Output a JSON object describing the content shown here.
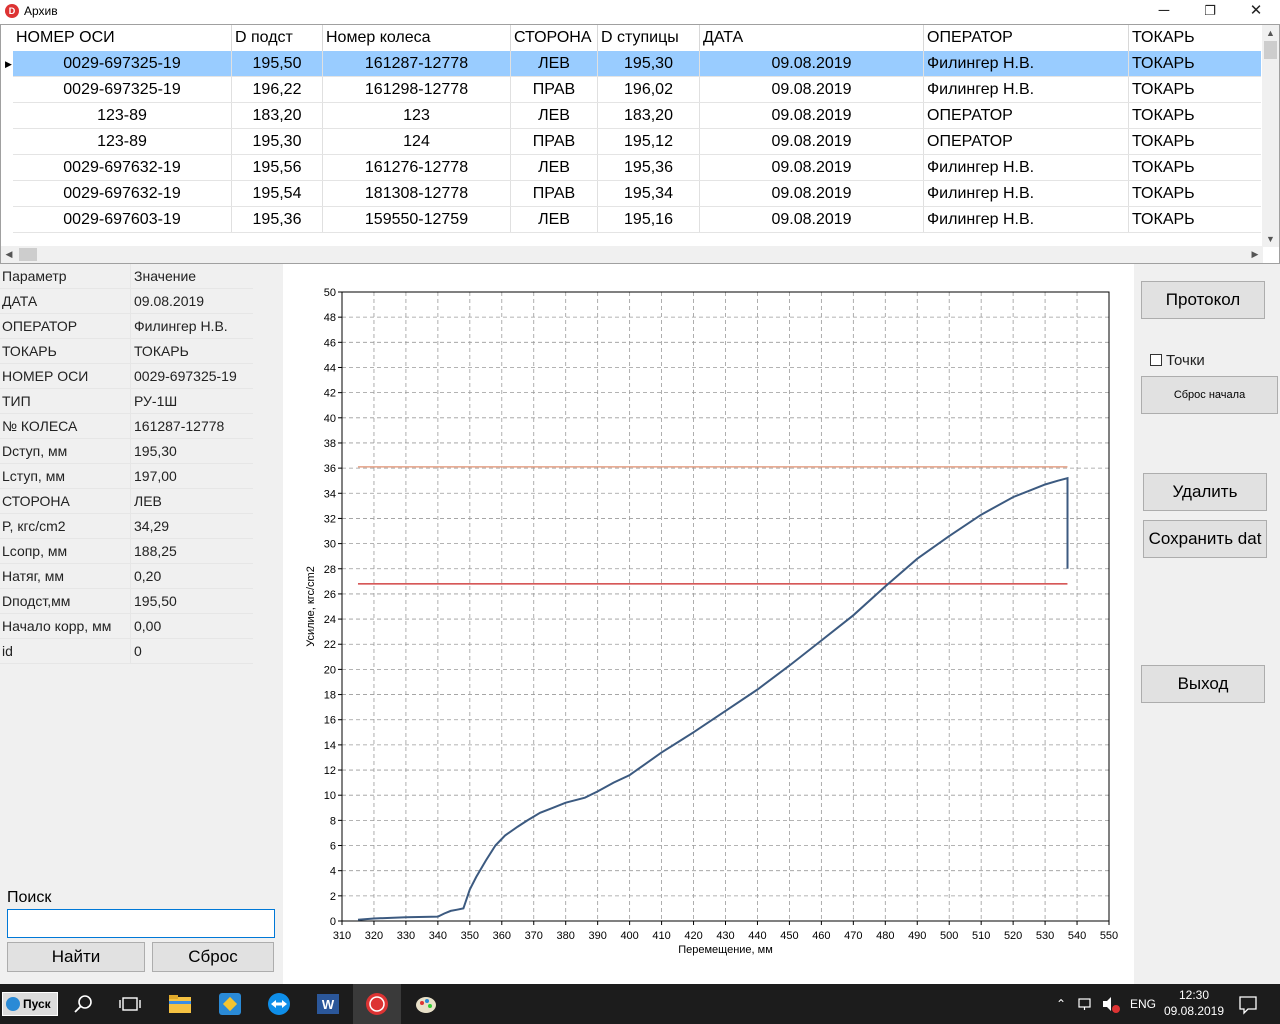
{
  "window": {
    "title": "Архив",
    "min": "─",
    "restore": "❐",
    "close": "✕"
  },
  "grid": {
    "columns": [
      "НОМЕР ОСИ",
      "D подст",
      "Номер колеса",
      "СТОРОНА",
      "D ступицы",
      "ДАТА",
      "ОПЕРАТОР",
      "ТОКАРЬ"
    ],
    "rows": [
      [
        "0029-697325-19",
        "195,50",
        "161287-12778",
        "ЛЕВ",
        "195,30",
        "09.08.2019",
        "Филингер Н.В.",
        "ТОКАРЬ"
      ],
      [
        "0029-697325-19",
        "196,22",
        "161298-12778",
        "ПРАВ",
        "196,02",
        "09.08.2019",
        "Филингер Н.В.",
        "ТОКАРЬ"
      ],
      [
        "123-89",
        "183,20",
        "123",
        "ЛЕВ",
        "183,20",
        "09.08.2019",
        "ОПЕРАТОР",
        "ТОКАРЬ"
      ],
      [
        "123-89",
        "195,30",
        "124",
        "ПРАВ",
        "195,12",
        "09.08.2019",
        "ОПЕРАТОР",
        "ТОКАРЬ"
      ],
      [
        "0029-697632-19",
        "195,56",
        "161276-12778",
        "ЛЕВ",
        "195,36",
        "09.08.2019",
        "Филингер Н.В.",
        "ТОКАРЬ"
      ],
      [
        "0029-697632-19",
        "195,54",
        "181308-12778",
        "ПРАВ",
        "195,34",
        "09.08.2019",
        "Филингер Н.В.",
        "ТОКАРЬ"
      ],
      [
        "0029-697603-19",
        "195,36",
        "159550-12759",
        "ЛЕВ",
        "195,16",
        "09.08.2019",
        "Филингер Н.В.",
        "ТОКАРЬ"
      ]
    ],
    "selected_row": 0,
    "selection_color": "#99ccff"
  },
  "params": {
    "header": [
      "Параметр",
      "Значение"
    ],
    "rows": [
      [
        "ДАТА",
        "09.08.2019"
      ],
      [
        "ОПЕРАТОР",
        "Филингер Н.В."
      ],
      [
        "ТОКАРЬ",
        "ТОКАРЬ"
      ],
      [
        "НОМЕР ОСИ",
        "0029-697325-19"
      ],
      [
        "ТИП",
        "РУ-1Ш"
      ],
      [
        "№ КОЛЕСА",
        "161287-12778"
      ],
      [
        "Dступ, мм",
        "195,30"
      ],
      [
        "Lступ, мм",
        "197,00"
      ],
      [
        "СТОРОНА",
        "ЛЕВ"
      ],
      [
        "P, кгс/cm2",
        "34,29"
      ],
      [
        "Lсопр, мм",
        "188,25"
      ],
      [
        "Натяг, мм",
        "0,20"
      ],
      [
        "Dподст,мм",
        "195,50"
      ],
      [
        "Начало корр, мм",
        "0,00"
      ],
      [
        "id",
        "0"
      ]
    ]
  },
  "search": {
    "label": "Поиск",
    "value": "",
    "find_button": "Найти",
    "reset_button": "Сброс"
  },
  "buttons": {
    "protocol": "Протокол",
    "points_label": "Точки",
    "points_checked": false,
    "reset_start": "Сброс начала",
    "delete": "Удалить",
    "save_dat": "Сохранить dat",
    "exit": "Выход"
  },
  "chart_data": {
    "type": "line",
    "xlabel": "Перемещение, мм",
    "ylabel": "Усилие, кгс/cm2",
    "xlim": [
      310,
      550
    ],
    "ylim": [
      0,
      50
    ],
    "xticks": [
      310,
      320,
      330,
      340,
      350,
      360,
      370,
      380,
      390,
      400,
      410,
      420,
      430,
      440,
      450,
      460,
      470,
      480,
      490,
      500,
      510,
      520,
      530,
      540,
      550
    ],
    "yticks": [
      0,
      2,
      4,
      6,
      8,
      10,
      12,
      14,
      16,
      18,
      20,
      22,
      24,
      26,
      28,
      30,
      32,
      34,
      36,
      38,
      40,
      42,
      44,
      46,
      48,
      50
    ],
    "grid": true,
    "series": [
      {
        "color": "#3c5a80",
        "x": [
          315,
          320,
          330,
          340,
          342,
          344,
          346,
          348,
          350,
          352,
          355,
          358,
          361,
          365,
          368,
          372,
          376,
          380,
          383,
          386,
          390,
          395,
          400,
          405,
          410,
          415,
          420,
          430,
          440,
          450,
          460,
          470,
          480,
          490,
          500,
          510,
          520,
          525,
          530,
          534,
          537,
          537
        ],
        "y": [
          0.1,
          0.2,
          0.3,
          0.35,
          0.6,
          0.8,
          0.9,
          1.0,
          2.5,
          3.5,
          4.8,
          6.0,
          6.8,
          7.5,
          8.0,
          8.6,
          9.0,
          9.4,
          9.6,
          9.8,
          10.3,
          11.0,
          11.6,
          12.5,
          13.4,
          14.2,
          15.0,
          16.7,
          18.4,
          20.3,
          22.3,
          24.3,
          26.6,
          28.8,
          30.6,
          32.3,
          33.7,
          34.2,
          34.7,
          35.0,
          35.2,
          28.0
        ]
      }
    ],
    "reference_lines": [
      {
        "y": 36.1,
        "x": [
          315,
          537
        ],
        "color": "#e09070"
      },
      {
        "y": 26.8,
        "x": [
          315,
          537
        ],
        "color": "#c82020"
      }
    ]
  },
  "taskbar": {
    "start_label": "Пуск",
    "lang": "ENG",
    "time": "12:30",
    "date": "09.08.2019"
  }
}
